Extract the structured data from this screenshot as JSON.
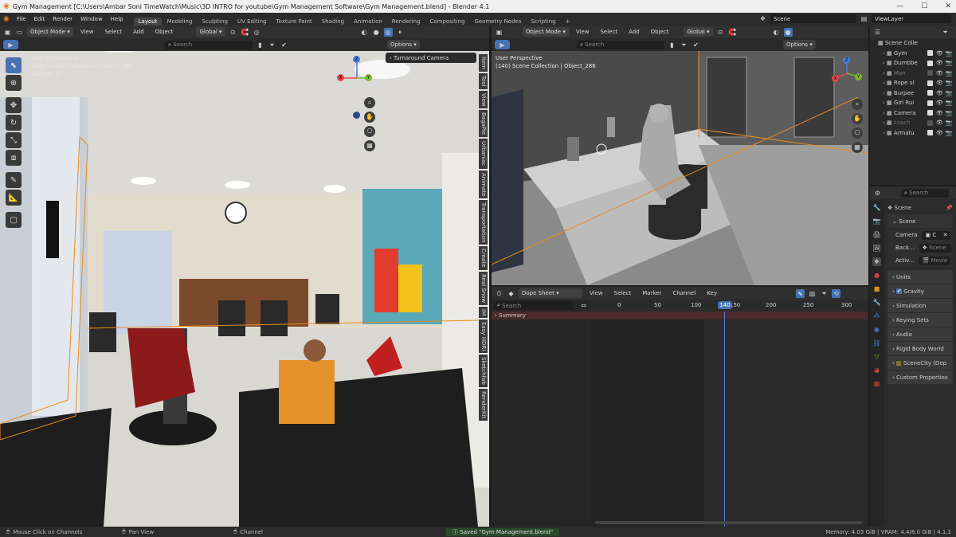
{
  "window": {
    "title": "Gym Management [C:\\Users\\Ambar Soni TimeWatch\\Music\\3D INTRO for youtube\\Gym Management Software\\Gym Management.blend] - Blender 4.1",
    "minimize": "—",
    "maximize": "☐",
    "close": "✕"
  },
  "menu": [
    "File",
    "Edit",
    "Render",
    "Window",
    "Help"
  ],
  "workspaces": [
    "Layout",
    "Modeling",
    "Sculpting",
    "UV Editing",
    "Texture Paint",
    "Shading",
    "Animation",
    "Rendering",
    "Compositing",
    "Geometry Nodes",
    "Scripting"
  ],
  "add_workspace": "+",
  "scene_field": "Scene",
  "viewlayer_field": "ViewLayer",
  "left_viewport": {
    "mode": "Object Mode",
    "menus": [
      "View",
      "Select",
      "Add",
      "Object"
    ],
    "orientation": "Global",
    "search_placeholder": "Search",
    "options": "Options",
    "info_lines": [
      "User Perspective",
      "(140) Scene Collection | Object_286",
      "Sample 13"
    ],
    "camera_popup": "Turnaround Camera",
    "n_tabs": [
      "Item",
      "Tool",
      "View",
      "BagaPie",
      "Urbaniac",
      "Animate",
      "Transportation",
      "Create",
      "Real Snow",
      "IM",
      "Easy HDRI",
      "Sketchfab",
      "RenderKit"
    ]
  },
  "right_viewport": {
    "mode": "Object Mode",
    "menus": [
      "View",
      "Select",
      "Add",
      "Object"
    ],
    "orientation": "Global",
    "search_placeholder": "Search",
    "options": "Options",
    "info_lines": [
      "User Perspective",
      "(140) Scene Collection | Object_286"
    ]
  },
  "gizmo": {
    "x": "X",
    "y": "Y",
    "z": "Z"
  },
  "dopesheet": {
    "editor": "Dope Sheet",
    "menus": [
      "View",
      "Select",
      "Marker",
      "Channel",
      "Key"
    ],
    "search_placeholder": "Search",
    "summary": "Summary",
    "ticks": [
      "0",
      "50",
      "100",
      "150",
      "200",
      "250",
      "300"
    ],
    "current_frame": "140"
  },
  "outliner": {
    "header": "Scene Colle",
    "items": [
      {
        "name": "Gym",
        "dim": false
      },
      {
        "name": "Dumbbe",
        "dim": false
      },
      {
        "name": "Man",
        "dim": true
      },
      {
        "name": "Rope sl",
        "dim": false
      },
      {
        "name": "Burpee",
        "dim": false
      },
      {
        "name": "Girl Rui",
        "dim": false
      },
      {
        "name": "Camera",
        "dim": false
      },
      {
        "name": "coach",
        "dim": true
      },
      {
        "name": "Armatu",
        "dim": false
      }
    ]
  },
  "properties": {
    "search_placeholder": "Search",
    "scene_name": "Scene",
    "panel_scene": "Scene",
    "camera_label": "Camera",
    "camera_value": "C",
    "background_label": "Back...",
    "background_value": "Scene",
    "active_label": "Activ...",
    "active_value": "Movie",
    "sections": [
      "Units",
      "Gravity",
      "Simulation",
      "Keying Sets",
      "Audio",
      "Rigid Body World",
      "SceneCity (Dep",
      "Custom Properties"
    ]
  },
  "status": {
    "left1": "Mouse Click on Channels",
    "left2": "Pan View",
    "left3": "Channel",
    "saved": "Saved \"Gym Management.blend\"",
    "memory": "Memory: 4.03 GiB | VRAM: 4.4/8.0 GiB | 4.1.1"
  },
  "colors": {
    "accent": "#4772b3",
    "selection": "#e88a1f",
    "summary": "#4a2a2a",
    "playhead": "#5b7ed6"
  }
}
